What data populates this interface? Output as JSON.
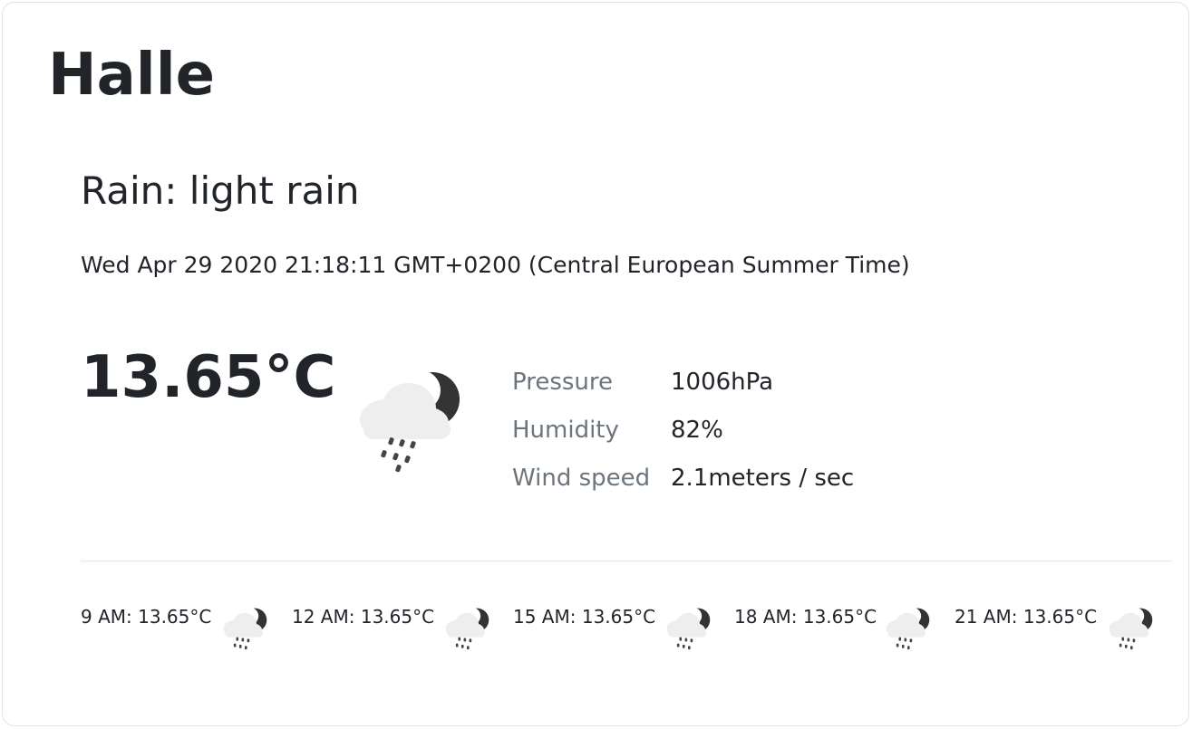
{
  "city": "Halle",
  "weather": {
    "description": "Rain: light rain",
    "datetime": "Wed Apr 29 2020 21:18:11 GMT+0200 (Central European Summer Time)",
    "temperature": "13.65°C",
    "icon": "night-rain-icon"
  },
  "stats": [
    {
      "label": "Pressure",
      "value": "1006hPa"
    },
    {
      "label": "Humidity",
      "value": "82%"
    },
    {
      "label": "Wind speed",
      "value": "2.1meters / sec"
    }
  ],
  "forecast": [
    {
      "label": "9 AM: 13.65°C",
      "icon": "night-rain-icon"
    },
    {
      "label": "12 AM: 13.65°C",
      "icon": "night-rain-icon"
    },
    {
      "label": "15 AM: 13.65°C",
      "icon": "night-rain-icon"
    },
    {
      "label": "18 AM: 13.65°C",
      "icon": "night-rain-icon"
    },
    {
      "label": "21 AM: 13.65°C",
      "icon": "night-rain-icon"
    }
  ],
  "colors": {
    "text": "#212529",
    "muted": "#6c757d",
    "cloud": "#eeeeee",
    "moon": "#333333",
    "rain": "#444444"
  }
}
